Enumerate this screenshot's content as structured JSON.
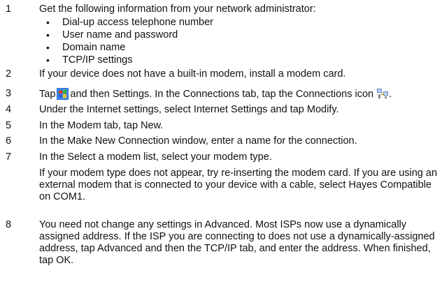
{
  "steps": [
    {
      "num": "1",
      "text": "Get the following information from your network administrator:"
    },
    {
      "num": "2",
      "text": "If your device does not have a built-in modem, install a modem card."
    },
    {
      "num": "3",
      "pre": "Tap",
      "mid": "and then Settings. In the Connections tab, tap the Connections icon",
      "post": "."
    },
    {
      "num": "4",
      "text": "Under the Internet settings, select Internet Settings and tap Modify."
    },
    {
      "num": "5",
      "text": "In the Modem tab, tap New."
    },
    {
      "num": "6",
      "text": "In the Make New Connection window, enter a name for the connection."
    },
    {
      "num": "7",
      "text": "In the Select a modem list, select your modem type.",
      "note": "If your modem type does not appear, try re-inserting the modem card. If you are using an external modem that is connected to your device with a cable, select Hayes Compatible on COM1."
    },
    {
      "num": "8",
      "text": "You need not change any settings in Advanced. Most ISPs now use a dynamically assigned address. If the ISP you are connecting to does not use a dynamically-assigned address, tap Advanced and then the TCP/IP tab, and enter the address. When finished, tap OK."
    }
  ],
  "bullets": [
    "Dial-up access telephone number",
    "User name and password",
    "Domain name",
    "TCP/IP settings"
  ],
  "bullet_glyph": "•",
  "icons": {
    "start": "windows-start-icon",
    "connections": "connections-icon"
  }
}
